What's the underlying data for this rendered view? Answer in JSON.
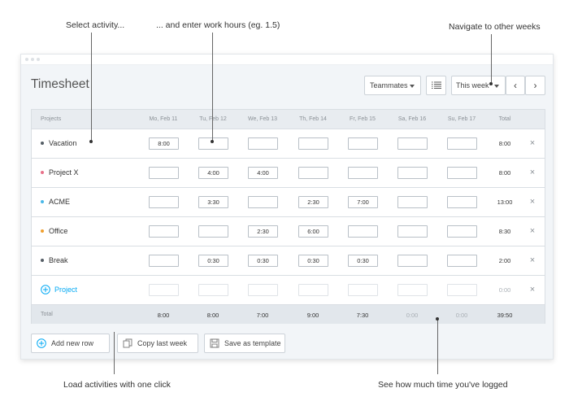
{
  "callouts": {
    "select_activity": "Select activity...",
    "enter_hours": "... and enter work hours (eg. 1.5)",
    "navigate": "Navigate to other weeks",
    "load": "Load activities with one click",
    "see_logged": "See how much time you've logged"
  },
  "header": {
    "title": "Timesheet",
    "teammates_label": "Teammates",
    "week_label": "This week"
  },
  "table": {
    "columns": [
      "Projects",
      "Mo, Feb 11",
      "Tu, Feb 12",
      "We, Feb 13",
      "Th, Feb 14",
      "Fr, Feb 15",
      "Sa, Feb 16",
      "Su, Feb 17",
      "Total"
    ],
    "rows": [
      {
        "name": "Vacation",
        "color": "#555e66",
        "cells": [
          "8:00",
          "",
          "",
          "",
          "",
          "",
          ""
        ],
        "total": "8:00"
      },
      {
        "name": "Project X",
        "color": "#e8718a",
        "cells": [
          "",
          "4:00",
          "4:00",
          "",
          "",
          "",
          ""
        ],
        "total": "8:00"
      },
      {
        "name": "ACME",
        "color": "#4ab8e8",
        "cells": [
          "",
          "3:30",
          "",
          "2:30",
          "7:00",
          "",
          ""
        ],
        "total": "13:00"
      },
      {
        "name": "Office",
        "color": "#f0a030",
        "cells": [
          "",
          "",
          "2:30",
          "6:00",
          "",
          "",
          ""
        ],
        "total": "8:30"
      },
      {
        "name": "Break",
        "color": "#555e66",
        "cells": [
          "",
          "0:30",
          "0:30",
          "0:30",
          "0:30",
          "",
          ""
        ],
        "total": "2:00"
      }
    ],
    "new_row": {
      "label": "Project",
      "total": "0:00"
    },
    "footer": {
      "label": "Total",
      "values": [
        "8:00",
        "8:00",
        "7:00",
        "9:00",
        "7:30",
        "0:00",
        "0:00"
      ],
      "total": "39:50"
    }
  },
  "actions": {
    "add_row": "Add new row",
    "copy_week": "Copy last week",
    "save_template": "Save as template"
  },
  "colors": {
    "accent": "#03a9f4",
    "border": "#d9dee3",
    "header_bg": "#e8ecf0"
  }
}
